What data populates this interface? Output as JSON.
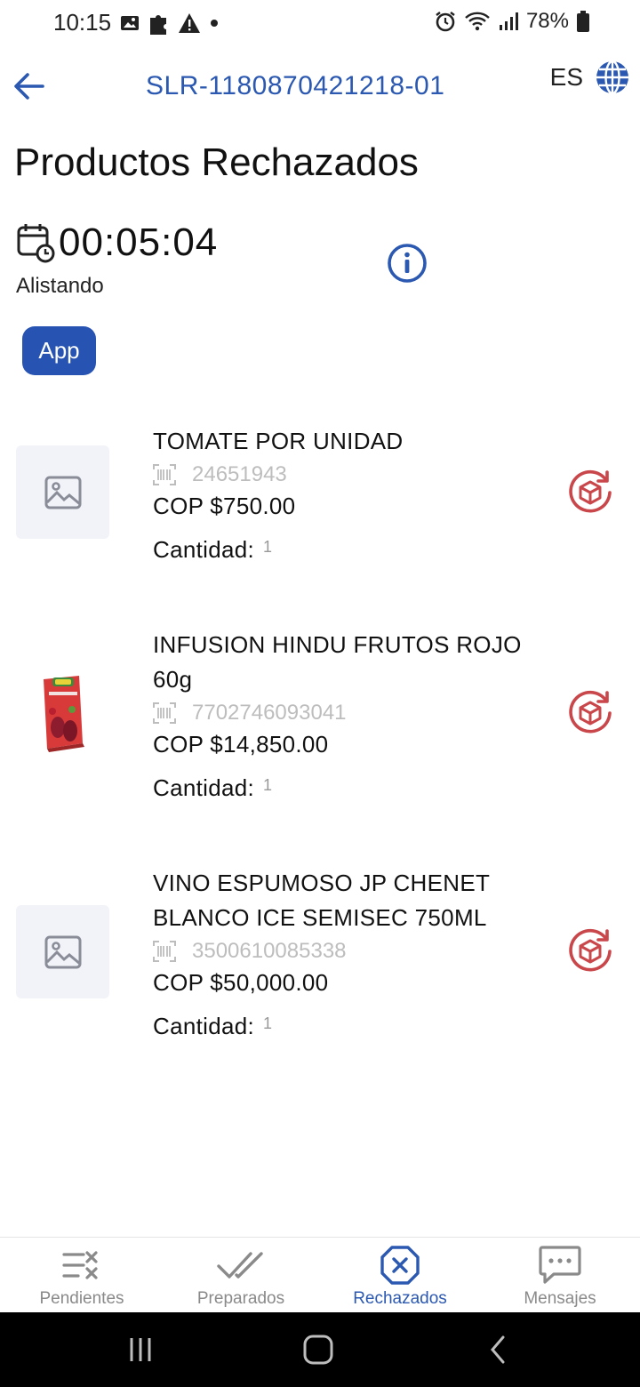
{
  "status_bar": {
    "time": "10:15",
    "battery": "78%",
    "icons": [
      "image-icon",
      "puzzle-icon",
      "warning-icon",
      "dot-icon",
      "alarm-icon",
      "wifi-icon",
      "signal-icon",
      "battery-icon"
    ]
  },
  "header": {
    "order_id": "SLR-1180870421218-01",
    "language": "ES"
  },
  "page": {
    "title": "Productos Rechazados",
    "timer": "00:05:04",
    "status": "Alistando",
    "source_badge": "App"
  },
  "products": [
    {
      "name": "TOMATE POR UNIDAD",
      "code": "24651943",
      "price": "COP $750.00",
      "quantity_label": "Cantidad:",
      "quantity": "1"
    },
    {
      "name": "INFUSION HINDU FRUTOS ROJO 60g",
      "code": "7702746093041",
      "price": "COP $14,850.00",
      "quantity_label": "Cantidad:",
      "quantity": "1"
    },
    {
      "name": "VINO ESPUMOSO JP CHENET BLANCO ICE SEMISEC 750ML",
      "code": "3500610085338",
      "price": "COP $50,000.00",
      "quantity_label": "Cantidad:",
      "quantity": "1"
    }
  ],
  "bottom_nav": {
    "items": [
      {
        "label": "Pendientes",
        "icon": "pending-list-icon"
      },
      {
        "label": "Preparados",
        "icon": "double-check-icon"
      },
      {
        "label": "Rechazados",
        "icon": "rejected-x-icon",
        "active": true
      },
      {
        "label": "Mensajes",
        "icon": "chat-icon"
      }
    ]
  },
  "colors": {
    "accent": "#2b58b0",
    "badge": "#2754b3",
    "restore": "#c9474a",
    "placeholder_bg": "#f1f3f8"
  }
}
